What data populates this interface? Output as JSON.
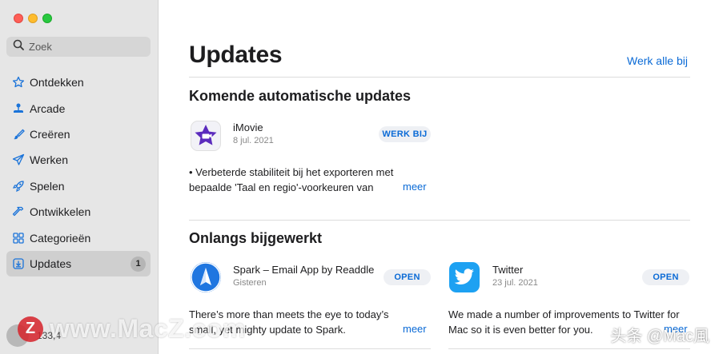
{
  "window": {
    "controls": [
      "close",
      "minimize",
      "zoom"
    ]
  },
  "sidebar": {
    "search": {
      "placeholder": "Zoek",
      "icon": "search-icon"
    },
    "items": [
      {
        "label": "Ontdekken",
        "icon": "star-icon",
        "active": false
      },
      {
        "label": "Arcade",
        "icon": "joystick-icon",
        "active": false
      },
      {
        "label": "Creëren",
        "icon": "brush-icon",
        "active": false
      },
      {
        "label": "Werken",
        "icon": "paper-plane-icon",
        "active": false
      },
      {
        "label": "Spelen",
        "icon": "rocket-icon",
        "active": false
      },
      {
        "label": "Ontwikkelen",
        "icon": "hammer-icon",
        "active": false
      },
      {
        "label": "Categorieën",
        "icon": "grid-icon",
        "active": false
      },
      {
        "label": "Updates",
        "icon": "download-icon",
        "active": true,
        "badge": "1"
      }
    ],
    "account": {
      "name": "133,4"
    }
  },
  "main": {
    "title": "Updates",
    "update_all": "Werk alle bij",
    "pending": {
      "title": "Komende automatische updates",
      "apps": [
        {
          "name": "iMovie",
          "date": "8 jul. 2021",
          "button": "WERK BIJ",
          "notes": "• Verbeterde stabiliteit bij het exporteren met bepaalde 'Taal en regio'-voorkeuren van macOS",
          "more": "meer",
          "icon": "imovie-star-icon"
        }
      ]
    },
    "recent": {
      "title": "Onlangs bijgewerkt",
      "apps": [
        {
          "name": "Spark – Email App by Readdle",
          "date": "Gisteren",
          "button": "OPEN",
          "notes": "There’s more than meets the eye to today’s small, yet mighty update to Spark.",
          "more": "meer",
          "icon": "spark-plane-icon"
        },
        {
          "name": "Twitter",
          "date": "23 jul. 2021",
          "button": "OPEN",
          "notes": "We made a number of improvements to Twitter for Mac so it is even better for you.",
          "more": "meer",
          "icon": "twitter-bird-icon"
        }
      ]
    }
  },
  "watermark": {
    "logo": "Z",
    "text": "www.MacZ.com",
    "secondary": "头条 @Mac風"
  },
  "colors": {
    "accent": "#0a6ad6",
    "sidebar_bg": "#e6e6e6",
    "active_bg": "#cfcfcf"
  }
}
